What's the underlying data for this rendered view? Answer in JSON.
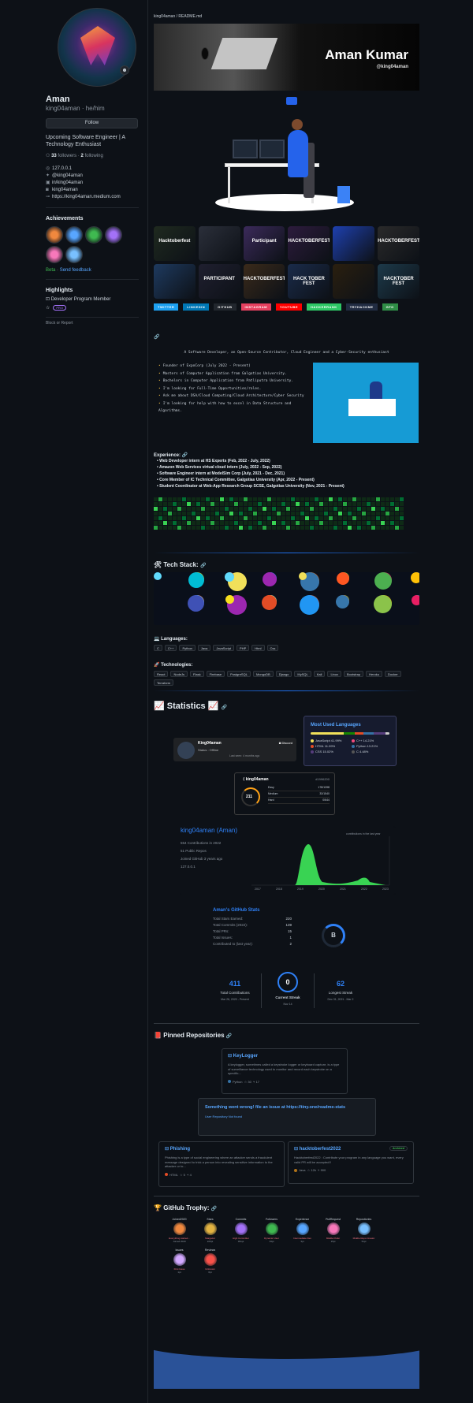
{
  "profile": {
    "name": "Aman",
    "username": "king04aman",
    "pronouns": "he/him",
    "follow_label": "Follow",
    "bio": "Upcoming Software Engineer | A Technology Enthusiast",
    "followers": "33",
    "followers_label": "followers",
    "following": "2",
    "following_label": "following",
    "location": "127.0.0.1",
    "twitter": "@king04aman",
    "linkedin": "in/king04aman",
    "instagram": "king04aman",
    "website": "https://king04aman.medium.com"
  },
  "achievements": {
    "title": "Achievements",
    "beta": "Beta",
    "feedback": "Send feedback",
    "colors": [
      "#f0883e",
      "#58a6ff",
      "#3fb950",
      "#a371f7",
      "#f778ba",
      "#79c0ff"
    ]
  },
  "highlights": {
    "title": "Highlights",
    "item": "Developer Program Member",
    "pro": "PRO",
    "block": "Block or Report"
  },
  "readme": {
    "path": "king04aman / README.md",
    "banner_name": "Aman Kumar",
    "banner_handle": "@king04aman",
    "hacktoberfest": [
      {
        "label": "Hacktoberfest",
        "color": "#1f2a1f"
      },
      {
        "label": "",
        "color": "#2b2f3a"
      },
      {
        "label": "Participant",
        "color": "#3b2a5a"
      },
      {
        "label": "HACKTOBERFEST",
        "color": "#2d1b3d"
      },
      {
        "label": "",
        "color": "#1e40af"
      },
      {
        "label": "HACKTOBERFEST",
        "color": "#2a2a2a"
      },
      {
        "label": "",
        "color": "#1e3a5f"
      },
      {
        "label": "PARTICIPANT",
        "color": "#1f1f2f"
      },
      {
        "label": "HACKTOBERFEST",
        "color": "#3a2a1a"
      },
      {
        "label": "HACK TOBER FEST",
        "color": "#1a2b4a"
      },
      {
        "label": "",
        "color": "#2a1f0f"
      },
      {
        "label": "HACKTOBER FEST",
        "color": "#1d3a4a"
      }
    ],
    "socials": [
      {
        "label": "TWITTER",
        "color": "#1da1f2"
      },
      {
        "label": "LINKEDIN",
        "color": "#0077b5"
      },
      {
        "label": "GITHUB",
        "color": "#21262d"
      },
      {
        "label": "INSTAGRAM",
        "color": "#e4405f"
      },
      {
        "label": "YOUTUBE",
        "color": "#ff0000"
      },
      {
        "label": "HACKERRANK",
        "color": "#2ec866"
      },
      {
        "label": "TRYHACKME",
        "color": "#212c42"
      },
      {
        "label": "GFG",
        "color": "#2f8d46"
      }
    ],
    "tagline": "A Software Developer, an Open-Source Contributor, Cloud Engineer and a Cyber-Security enthusiast",
    "intro": [
      "Founder of ExpoCorp (July 2022 - Present)",
      "Masters of Computer Application from Galgotias University.",
      "Bachelors in Computer Application from Patliputra University.",
      "I'm looking for Full-Time Opportunities/roles.",
      "Ask me about DSA/Cloud Computing/Cloud Architecture/Cyber Security",
      "I'm looking for help with how to excel in Data Structure and Algorithms."
    ],
    "experience_title": "Experience:",
    "experience": [
      "Web Developer intern at HS Experts (Feb, 2022 - July, 2022)",
      "Amazon Web Services virtual cloud intern (July, 2022 - Sep, 2022)",
      "Software Engineer intern at ModelSim Corp (July, 2021 - Dec, 2021)",
      "Core Member of IC Technical Committee, Galgotias University (Apr, 2022 - Present)",
      "Student Coordinator at Web-App Research Group SCSE, Galgotias University (Nov, 2021 - Present)"
    ]
  },
  "tech": {
    "title": "Tech Stack:",
    "languages_title": "Languages:",
    "languages": [
      "C",
      "C++",
      "Python",
      "Java",
      "JavaScript",
      "PHP",
      "Html",
      "Css"
    ],
    "tech_title": "Technologies:",
    "technologies": [
      "React",
      "NodeJs",
      "Flask",
      "Firebase",
      "PostgreSQL",
      "MongoDB",
      "Django",
      "MySQL",
      "Kali",
      "Linux",
      "Bootstrap",
      "Heroku",
      "Docker",
      "Terraform"
    ]
  },
  "stats": {
    "title": "Statistics",
    "mul_title": "Most Used Languages",
    "mul": [
      {
        "name": "JavaScript 41.99%",
        "color": "#f1e05a"
      },
      {
        "name": "C++ 14.21%",
        "color": "#f34b7d"
      },
      {
        "name": "HTML 11.09%",
        "color": "#e34c26"
      },
      {
        "name": "Python 13.21%",
        "color": "#3572A5"
      },
      {
        "name": "CSS 15.02%",
        "color": "#563d7c"
      },
      {
        "name": "C 4.48%",
        "color": "#555555"
      }
    ],
    "discord_name": "King04aman",
    "discord_status": "Status : Offline",
    "discord_last": "Last seen: 4 months ago",
    "discord_label": "Discord",
    "leet_user": "king04aman",
    "leet_rank": "#1996200",
    "leet_solved": "211",
    "leet_rows": [
      {
        "k": "Easy",
        "v": "178/1398"
      },
      {
        "k": "Medium",
        "v": "33/1540"
      },
      {
        "k": "Hard",
        "v": "0/644"
      }
    ],
    "gh_name": "king04aman (Aman)",
    "gh_items": [
      "554 Contributions in 2022",
      "51 Public Repos",
      "Joined GitHub 3 years ago",
      "127.0.0.1"
    ],
    "gh_legend": "contributions in the last year",
    "gh_years": [
      "2017",
      "2018",
      "2019",
      "2020",
      "2021",
      "2022",
      "2023"
    ],
    "card_title": "Aman's GitHub Stats",
    "card_rows": [
      {
        "k": "Total Stars Earned:",
        "v": "220"
      },
      {
        "k": "Total Commits (2022):",
        "v": "139"
      },
      {
        "k": "Total PRs:",
        "v": "15"
      },
      {
        "k": "Total Issues:",
        "v": "1"
      },
      {
        "k": "Contributed to (last year):",
        "v": "2"
      }
    ],
    "grade": "B",
    "total_contrib": "411",
    "total_contrib_label": "Total Contributions",
    "total_contrib_date": "Mar 26, 2020 - Present",
    "current": "0",
    "current_label": "Current Streak",
    "current_date": "Nov 14",
    "longest": "62",
    "longest_label": "Longest Streak",
    "longest_date": "Dec 31, 2021 - Mar 2"
  },
  "pinned": {
    "title": "Pinned Repositories",
    "error_title": "Something went wrong! file an issue at https://tiny.one/readme-stats",
    "error_sub": "User Repository Not found",
    "archived": "Archived",
    "repos": [
      {
        "name": "KeyLogger",
        "desc": "A keylogger, sometimes called a keystroke logger or keyboard capture, is a type of surveillance technology used to monitor and record each keystroke on a specific...",
        "lang": "Python",
        "stars": "30",
        "forks": "17",
        "color": "#3572A5"
      },
      {
        "name": "Phishing",
        "desc": "Phishing is a type of social engineering where an attacker sends a fraudulent message designed to trick a person into revealing sensitive information to the attacker or to...",
        "lang": "HTML",
        "stars": "5",
        "forks": "4",
        "color": "#e34c26"
      },
      {
        "name": "hacktoberfest2022",
        "desc": "Hacktoberfest2022 : Contribute your program in any language you want, every valid PR will be accepted!!",
        "lang": "Java",
        "stars": "12k",
        "forks": "900",
        "color": "#b07219"
      }
    ]
  },
  "trophy": {
    "title": "GitHub Trophy:",
    "items": [
      {
        "title": "Joined2020",
        "label": "Everything started...",
        "pts": "Joined 2020",
        "color": "#f0883e"
      },
      {
        "title": "Stars",
        "label": "Stargazer",
        "pts": "220pt",
        "color": "#e3b341"
      },
      {
        "title": "Commits",
        "label": "High Committer",
        "pts": "391pt",
        "color": "#a371f7"
      },
      {
        "title": "Followers",
        "label": "Dynamic User",
        "pts": "33pt",
        "color": "#3fb950"
      },
      {
        "title": "Experience",
        "label": "Intermediate Dev",
        "pts": "3pt",
        "color": "#58a6ff"
      },
      {
        "title": "PullRequest",
        "label": "Middle Puller",
        "pts": "15pt",
        "color": "#f778ba"
      },
      {
        "title": "Repositories",
        "label": "Middle Repo Creator",
        "pts": "51pt",
        "color": "#79c0ff"
      },
      {
        "title": "Issues",
        "label": "First Issue",
        "pts": "1pt",
        "color": "#d2a8ff"
      },
      {
        "title": "Reviews",
        "label": "Unknown",
        "pts": "0pt",
        "color": "#f85149"
      }
    ]
  }
}
